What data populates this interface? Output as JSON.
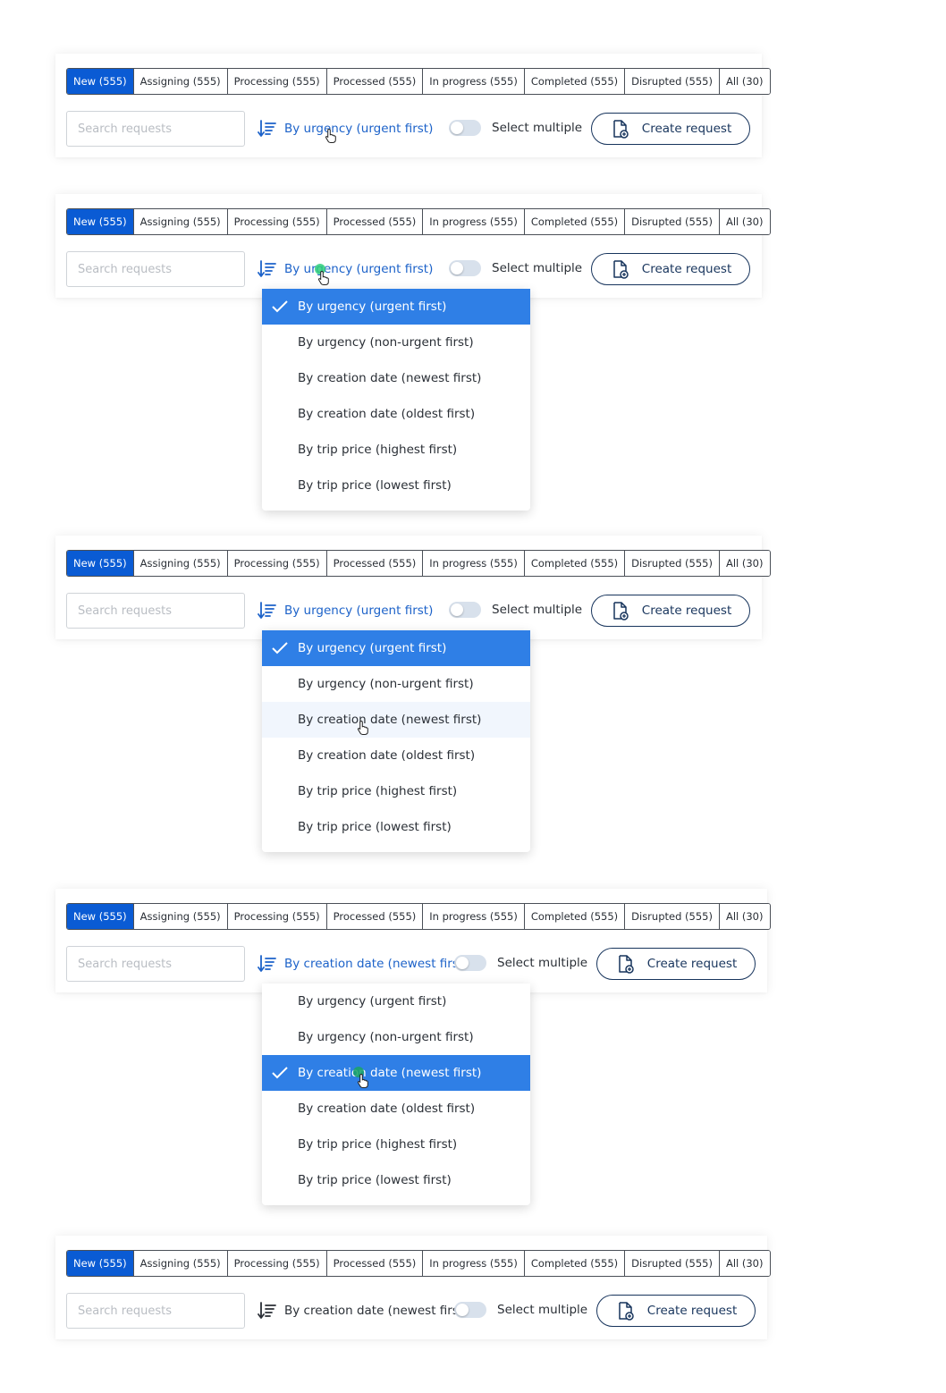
{
  "tabs": [
    "New (555)",
    "Assigning (555)",
    "Processing (555)",
    "Processed (555)",
    "In progress (555)",
    "Completed (555)",
    "Disrupted (555)",
    "All (30)"
  ],
  "search_placeholder": "Search requests",
  "toggle_label": "Select multiple",
  "create_label": "Create request",
  "sort_options": [
    "By urgency (urgent first)",
    "By urgency (non-urgent first)",
    "By creation date (newest first)",
    "By creation date (oldest first)",
    "By trip price (highest first)",
    "By trip price (lowest first)"
  ],
  "sort_label_urgency": "By urgency (urgent first)",
  "sort_label_creation": "By creation date (newest first)",
  "colors": {
    "active_tab": "#0a5bd4",
    "selected_option": "#2f7fe6",
    "link": "#1c62c9",
    "button_border": "#17345c"
  },
  "icons": {
    "sort": "sort-descending-icon",
    "create": "document-add-icon",
    "check": "check-icon",
    "cursor": "hand-pointer-icon"
  }
}
